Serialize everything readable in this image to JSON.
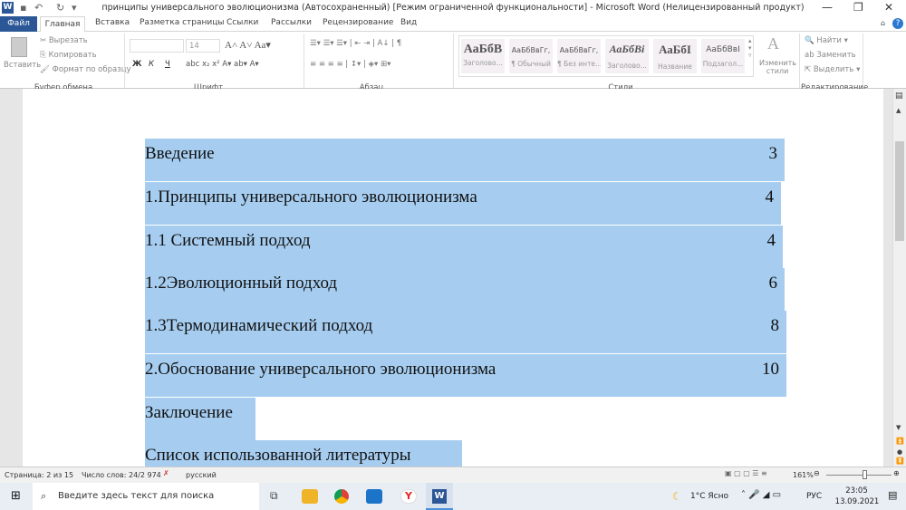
{
  "window": {
    "title": "принципы универсального эволюционизма (Автосохраненный) [Режим ограниченной функциональности]  -  Microsoft Word (Нелицензированный продукт)"
  },
  "tabs": [
    "Файл",
    "Главная",
    "Вставка",
    "Разметка страницы",
    "Ссылки",
    "Рассылки",
    "Рецензирование",
    "Вид"
  ],
  "clipboard": {
    "paste": "Вставить",
    "cut": "Вырезать",
    "copy": "Копировать",
    "format_painter": "Формат по образцу",
    "label": "Буфер обмена"
  },
  "font": {
    "size": "14",
    "label": "Шрифт",
    "bold": "Ж",
    "italic": "К",
    "underline": "Ч"
  },
  "paragraph": {
    "label": "Абзац"
  },
  "styles": {
    "label": "Стили",
    "items": [
      {
        "sample": "АаБбВ",
        "name": "Заголово..."
      },
      {
        "sample": "АаБбВвГг,",
        "name": "¶ Обычный"
      },
      {
        "sample": "АаБбВвГг,",
        "name": "¶ Без инте..."
      },
      {
        "sample": "АаБбВі",
        "name": "Заголово..."
      },
      {
        "sample": "АаБбІ",
        "name": "Название"
      },
      {
        "sample": "АаБбВвІ",
        "name": "Подзагол..."
      }
    ],
    "change": "Изменить стили"
  },
  "editing": {
    "label": "Редактирование",
    "find": "Найти",
    "replace": "Заменить",
    "select": "Выделить"
  },
  "toc": [
    {
      "text": "Введение",
      "page": "3",
      "w": 706
    },
    {
      "text": "1.Принципы универсального эволюционизма",
      "page": "4",
      "w": 702
    },
    {
      "text": "1.1 Системный подход",
      "page": "4",
      "w": 704
    },
    {
      "text": "1.2Эволюционный подход",
      "page": "6",
      "w": 706
    },
    {
      "text": "1.3Термодинамический подход",
      "page": "8",
      "w": 708
    },
    {
      "text": "2.Обоснование универсального эволюционизма",
      "page": "10",
      "w": 708
    },
    {
      "text": "Заключение",
      "page": "",
      "w": 122
    },
    {
      "text": "Список использованной литературы",
      "page": "",
      "w": 350
    }
  ],
  "status": {
    "page": "Страница: 2 из 15",
    "words": "Число слов: 24/2 974",
    "lang": "русский",
    "zoom": "161%"
  },
  "taskbar": {
    "search_placeholder": "Введите здесь текст для поиска",
    "weather": "1°C  Ясно",
    "lang": "РУС",
    "time": "23:05",
    "date": "13.09.2021",
    "notif": "1"
  },
  "colors": {
    "selection": "#a6cdf0",
    "file_tab": "#2b5797"
  }
}
